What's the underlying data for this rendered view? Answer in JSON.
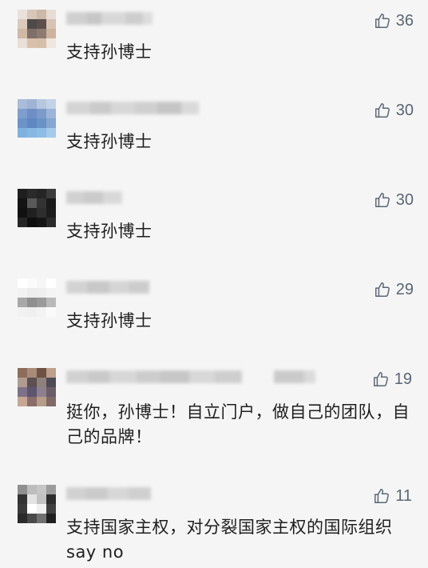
{
  "comments": [
    {
      "likes": "36",
      "text": "支持孙博士",
      "avatar_colors": [
        "#e9e2dc",
        "#d8c6b8",
        "#cdb8a7",
        "#e7ddd6",
        "#dbc9bb",
        "#4e4a49",
        "#5d504c",
        "#d6c3b3",
        "#d0b8a6",
        "#7f6f68",
        "#8c7b70",
        "#cdb39f",
        "#e9dfd6",
        "#d8c0ac",
        "#d6bfa9",
        "#eee5de"
      ]
    },
    {
      "likes": "30",
      "text": "支持孙博士",
      "avatar_colors": [
        "#a9bcd9",
        "#9fb4d4",
        "#b7c7df",
        "#c3d2e6",
        "#7f9dcd",
        "#6e8fc6",
        "#7d9bca",
        "#9db4d8",
        "#6c93c8",
        "#5f87c1",
        "#6a92c6",
        "#85a6d1",
        "#7fb1df",
        "#86b8e3",
        "#8dbde4",
        "#a4c9e9"
      ]
    },
    {
      "likes": "30",
      "text": "支持孙博士",
      "avatar_colors": [
        "#1e1e1e",
        "#2a2a2a",
        "#252525",
        "#3b3b3b",
        "#141414",
        "#595959",
        "#333333",
        "#1a1a1a",
        "#111111",
        "#202020",
        "#2e2e2e",
        "#1c1c1c",
        "#262626",
        "#0f0f0f",
        "#151515",
        "#2b2b2b"
      ]
    },
    {
      "likes": "29",
      "text": "支持孙博士",
      "avatar_colors": [
        "#ffffff",
        "#fbfbfb",
        "#f6f6f6",
        "#ffffff",
        "#f2f2f2",
        "#ededed",
        "#eeeeee",
        "#f4f4f4",
        "#a8a8a8",
        "#8f8f8f",
        "#9a9a9a",
        "#b9b9b9",
        "#f1f1f1",
        "#efefef",
        "#f3f3f3",
        "#fafafa"
      ]
    },
    {
      "likes": "19",
      "text": "挺你，孙博士！自立门户，做自己的团队，自己的品牌！",
      "avatar_colors": [
        "#8d6d5a",
        "#a88b78",
        "#6e5244",
        "#bca08b",
        "#b19b90",
        "#5e4f51",
        "#8f807a",
        "#4f4b56",
        "#7d7188",
        "#5d5470",
        "#8e7f8d",
        "#6b5d67",
        "#c7a693",
        "#8b6d68",
        "#b79d88",
        "#7f6a68"
      ]
    },
    {
      "likes": "11",
      "text": "支持国家主权，对分裂国家主权的国际组织say no",
      "avatar_colors": [
        "#8f8f8f",
        "#bdbdbd",
        "#c6c6c6",
        "#9b9b9b",
        "#333333",
        "#e3e3e3",
        "#c2c2c2",
        "#2e2e2e",
        "#3a3a3a",
        "#ffffff",
        "#f0f0f0",
        "#404040",
        "#2b2b2b",
        "#4a4a4a",
        "#707070",
        "#202020"
      ]
    }
  ],
  "like_icon": "thumbs-up-icon",
  "colors": {
    "background": "#f5f5f5",
    "text": "#1e1e1e",
    "like": "#5a6675"
  }
}
